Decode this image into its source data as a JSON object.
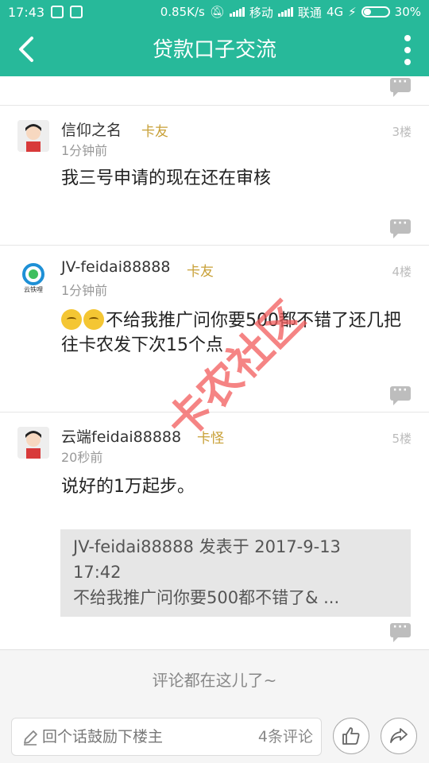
{
  "status_bar": {
    "time": "17:43",
    "network_speed": "0.85K/s",
    "carrier1": "移动",
    "carrier2": "联通",
    "network_type": "4G",
    "battery": "30%",
    "battery_level": 0.3
  },
  "header": {
    "title": "贷款口子交流"
  },
  "posts": [
    {
      "username": "信仰之名",
      "tag": "卡友",
      "time": "1分钟前",
      "floor": "3楼",
      "content": "我三号申请的现在还在审核"
    },
    {
      "username": "JV-feidai88888",
      "tag": "卡友",
      "time": "1分钟前",
      "floor": "4楼",
      "content": "不给我推广问你要500都不错了还几把往卡农发下次15个点",
      "avatar_text": "云铁哩"
    },
    {
      "username": "云端feidai88888",
      "tag": "卡怪",
      "time": "20秒前",
      "floor": "5楼",
      "content": "说好的1万起步。",
      "quote": {
        "line1": "JV-feidai88888 发表于 2017-9-13",
        "line2": "17:42",
        "line3": "不给我推广问你要500都不错了& ..."
      }
    }
  ],
  "watermark": {
    "text": "卡农社区"
  },
  "footer": {
    "hint": "评论都在这儿了~"
  },
  "bottom_bar": {
    "placeholder": "回个话鼓励下楼主",
    "comment_count": "4条评论"
  },
  "colors": {
    "brand": "#27b99a",
    "tag": "#c8a037",
    "watermark": "#f25c5c"
  }
}
